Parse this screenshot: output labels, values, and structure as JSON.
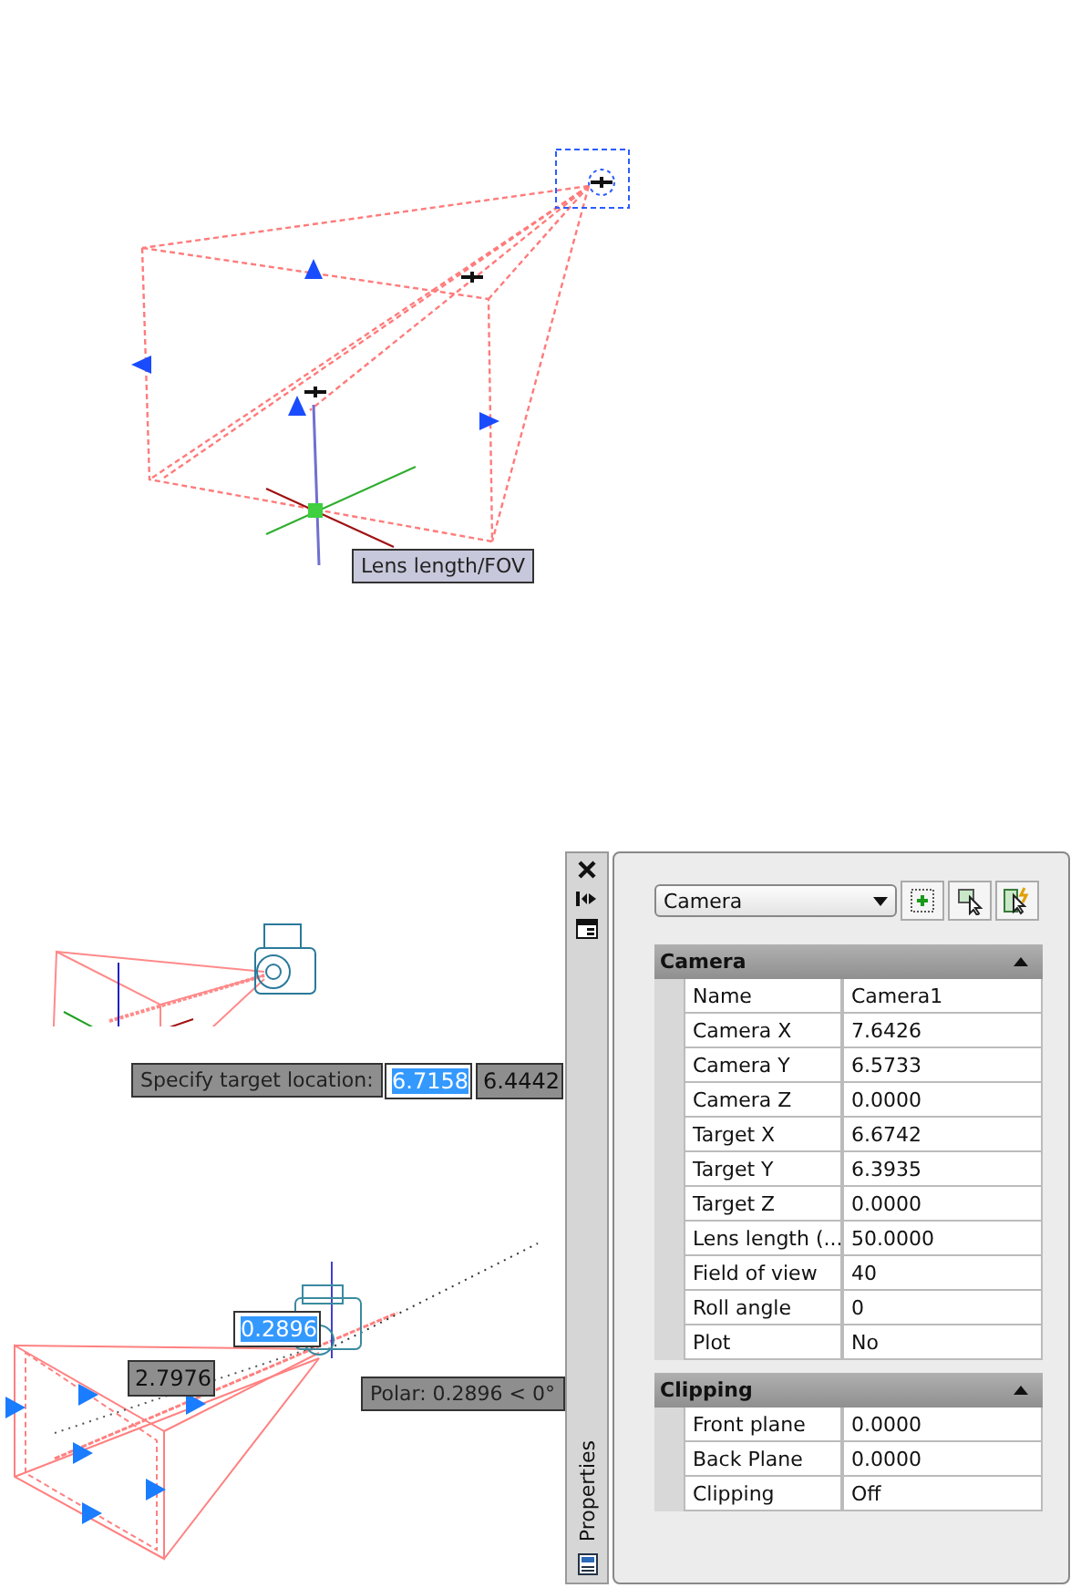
{
  "top_view": {
    "tooltip": "Lens length/FOV"
  },
  "target_view": {
    "prompt": "Specify target location:",
    "inputs": [
      {
        "value": "6.7158",
        "selected": true
      },
      {
        "value": "6.4442",
        "selected": false
      }
    ]
  },
  "polar_view": {
    "inputs": [
      {
        "value": "0.2896",
        "selected": true
      },
      {
        "value": "2.7976",
        "selected": false
      }
    ],
    "tooltip": "Polar: 0.2896 < 0°"
  },
  "properties": {
    "tab_label": "Properties",
    "selector": "Camera",
    "sections": [
      {
        "title": "Camera",
        "expanded": true,
        "rows": [
          {
            "label": "Name",
            "value": "Camera1"
          },
          {
            "label": "Camera X",
            "value": "7.6426"
          },
          {
            "label": "Camera Y",
            "value": "6.5733"
          },
          {
            "label": "Camera Z",
            "value": "0.0000"
          },
          {
            "label": "Target X",
            "value": "6.6742"
          },
          {
            "label": "Target Y",
            "value": "6.3935"
          },
          {
            "label": "Target Z",
            "value": "0.0000"
          },
          {
            "label": "Lens length (...",
            "value": "50.0000"
          },
          {
            "label": "Field of view",
            "value": "40"
          },
          {
            "label": "Roll angle",
            "value": "0"
          },
          {
            "label": "Plot",
            "value": "No"
          }
        ]
      },
      {
        "title": "Clipping",
        "expanded": true,
        "rows": [
          {
            "label": "Front plane",
            "value": "0.0000"
          },
          {
            "label": "Back Plane",
            "value": "0.0000"
          },
          {
            "label": "Clipping",
            "value": "Off"
          }
        ]
      }
    ]
  }
}
